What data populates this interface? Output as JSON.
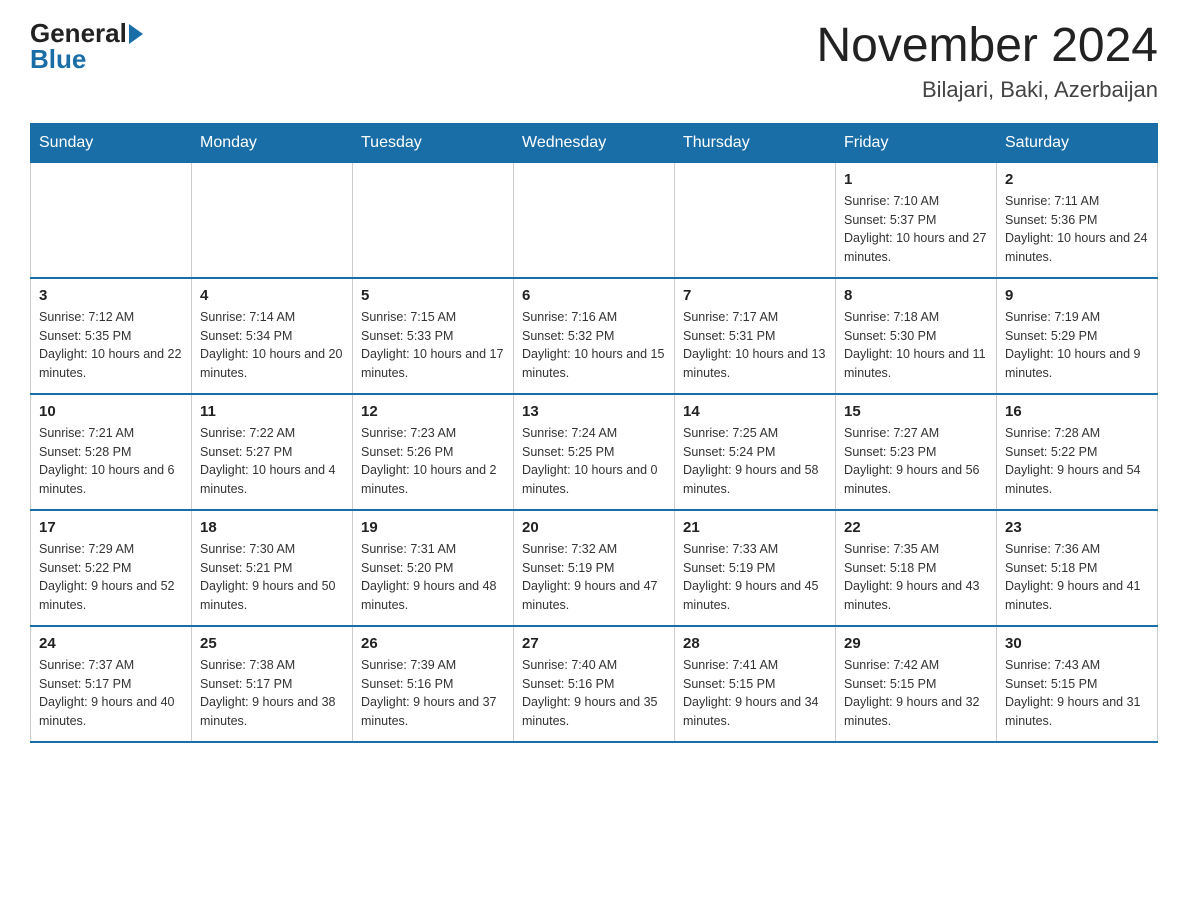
{
  "header": {
    "logo_general": "General",
    "logo_blue": "Blue",
    "title": "November 2024",
    "subtitle": "Bilajari, Baki, Azerbaijan"
  },
  "weekdays": [
    "Sunday",
    "Monday",
    "Tuesday",
    "Wednesday",
    "Thursday",
    "Friday",
    "Saturday"
  ],
  "weeks": [
    [
      {
        "day": "",
        "info": ""
      },
      {
        "day": "",
        "info": ""
      },
      {
        "day": "",
        "info": ""
      },
      {
        "day": "",
        "info": ""
      },
      {
        "day": "",
        "info": ""
      },
      {
        "day": "1",
        "info": "Sunrise: 7:10 AM\nSunset: 5:37 PM\nDaylight: 10 hours and 27 minutes."
      },
      {
        "day": "2",
        "info": "Sunrise: 7:11 AM\nSunset: 5:36 PM\nDaylight: 10 hours and 24 minutes."
      }
    ],
    [
      {
        "day": "3",
        "info": "Sunrise: 7:12 AM\nSunset: 5:35 PM\nDaylight: 10 hours and 22 minutes."
      },
      {
        "day": "4",
        "info": "Sunrise: 7:14 AM\nSunset: 5:34 PM\nDaylight: 10 hours and 20 minutes."
      },
      {
        "day": "5",
        "info": "Sunrise: 7:15 AM\nSunset: 5:33 PM\nDaylight: 10 hours and 17 minutes."
      },
      {
        "day": "6",
        "info": "Sunrise: 7:16 AM\nSunset: 5:32 PM\nDaylight: 10 hours and 15 minutes."
      },
      {
        "day": "7",
        "info": "Sunrise: 7:17 AM\nSunset: 5:31 PM\nDaylight: 10 hours and 13 minutes."
      },
      {
        "day": "8",
        "info": "Sunrise: 7:18 AM\nSunset: 5:30 PM\nDaylight: 10 hours and 11 minutes."
      },
      {
        "day": "9",
        "info": "Sunrise: 7:19 AM\nSunset: 5:29 PM\nDaylight: 10 hours and 9 minutes."
      }
    ],
    [
      {
        "day": "10",
        "info": "Sunrise: 7:21 AM\nSunset: 5:28 PM\nDaylight: 10 hours and 6 minutes."
      },
      {
        "day": "11",
        "info": "Sunrise: 7:22 AM\nSunset: 5:27 PM\nDaylight: 10 hours and 4 minutes."
      },
      {
        "day": "12",
        "info": "Sunrise: 7:23 AM\nSunset: 5:26 PM\nDaylight: 10 hours and 2 minutes."
      },
      {
        "day": "13",
        "info": "Sunrise: 7:24 AM\nSunset: 5:25 PM\nDaylight: 10 hours and 0 minutes."
      },
      {
        "day": "14",
        "info": "Sunrise: 7:25 AM\nSunset: 5:24 PM\nDaylight: 9 hours and 58 minutes."
      },
      {
        "day": "15",
        "info": "Sunrise: 7:27 AM\nSunset: 5:23 PM\nDaylight: 9 hours and 56 minutes."
      },
      {
        "day": "16",
        "info": "Sunrise: 7:28 AM\nSunset: 5:22 PM\nDaylight: 9 hours and 54 minutes."
      }
    ],
    [
      {
        "day": "17",
        "info": "Sunrise: 7:29 AM\nSunset: 5:22 PM\nDaylight: 9 hours and 52 minutes."
      },
      {
        "day": "18",
        "info": "Sunrise: 7:30 AM\nSunset: 5:21 PM\nDaylight: 9 hours and 50 minutes."
      },
      {
        "day": "19",
        "info": "Sunrise: 7:31 AM\nSunset: 5:20 PM\nDaylight: 9 hours and 48 minutes."
      },
      {
        "day": "20",
        "info": "Sunrise: 7:32 AM\nSunset: 5:19 PM\nDaylight: 9 hours and 47 minutes."
      },
      {
        "day": "21",
        "info": "Sunrise: 7:33 AM\nSunset: 5:19 PM\nDaylight: 9 hours and 45 minutes."
      },
      {
        "day": "22",
        "info": "Sunrise: 7:35 AM\nSunset: 5:18 PM\nDaylight: 9 hours and 43 minutes."
      },
      {
        "day": "23",
        "info": "Sunrise: 7:36 AM\nSunset: 5:18 PM\nDaylight: 9 hours and 41 minutes."
      }
    ],
    [
      {
        "day": "24",
        "info": "Sunrise: 7:37 AM\nSunset: 5:17 PM\nDaylight: 9 hours and 40 minutes."
      },
      {
        "day": "25",
        "info": "Sunrise: 7:38 AM\nSunset: 5:17 PM\nDaylight: 9 hours and 38 minutes."
      },
      {
        "day": "26",
        "info": "Sunrise: 7:39 AM\nSunset: 5:16 PM\nDaylight: 9 hours and 37 minutes."
      },
      {
        "day": "27",
        "info": "Sunrise: 7:40 AM\nSunset: 5:16 PM\nDaylight: 9 hours and 35 minutes."
      },
      {
        "day": "28",
        "info": "Sunrise: 7:41 AM\nSunset: 5:15 PM\nDaylight: 9 hours and 34 minutes."
      },
      {
        "day": "29",
        "info": "Sunrise: 7:42 AM\nSunset: 5:15 PM\nDaylight: 9 hours and 32 minutes."
      },
      {
        "day": "30",
        "info": "Sunrise: 7:43 AM\nSunset: 5:15 PM\nDaylight: 9 hours and 31 minutes."
      }
    ]
  ]
}
